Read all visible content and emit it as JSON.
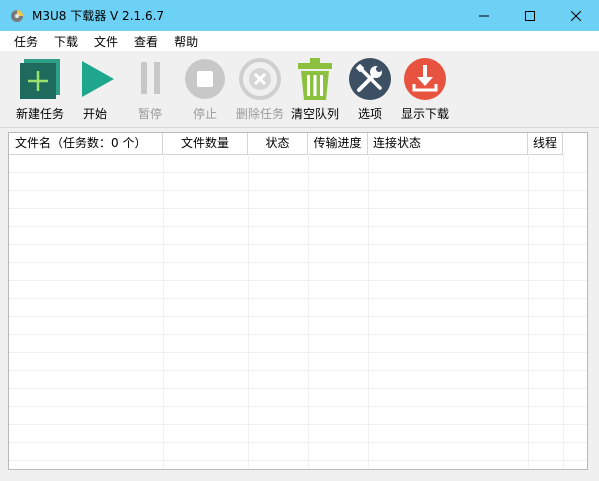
{
  "window": {
    "title": "M3U8 下载器 V 2.1.6.7",
    "minimize_icon": "minimize-icon",
    "maximize_icon": "maximize-icon",
    "close_icon": "close-icon"
  },
  "menu": [
    {
      "label": "任务"
    },
    {
      "label": "下载"
    },
    {
      "label": "文件"
    },
    {
      "label": "查看"
    },
    {
      "label": "帮助"
    }
  ],
  "toolbar": [
    {
      "label": "新建任务",
      "icon": "new-task-icon",
      "enabled": true,
      "color": "#1e7a6a"
    },
    {
      "label": "开始",
      "icon": "play-icon",
      "enabled": true,
      "color": "#1fa78d"
    },
    {
      "label": "暂停",
      "icon": "pause-icon",
      "enabled": false,
      "color": "#c8c8c8"
    },
    {
      "label": "停止",
      "icon": "stop-icon",
      "enabled": false,
      "color": "#c8c8c8"
    },
    {
      "label": "删除任务",
      "icon": "delete-task-icon",
      "enabled": false,
      "color": "#c8c8c8"
    },
    {
      "label": "清空队列",
      "icon": "trash-icon",
      "enabled": true,
      "color": "#8cc13f"
    },
    {
      "label": "选项",
      "icon": "tools-icon",
      "enabled": true,
      "color": "#3d4f63"
    },
    {
      "label": "显示下载",
      "icon": "download-icon",
      "enabled": true,
      "color": "#e8533f"
    }
  ],
  "list": {
    "columns": [
      {
        "label": "文件名（任务数：0 个）"
      },
      {
        "label": "文件数量"
      },
      {
        "label": "状态"
      },
      {
        "label": "传输进度"
      },
      {
        "label": "连接状态"
      },
      {
        "label": "线程"
      }
    ],
    "rows": []
  },
  "colors": {
    "titlebar": "#6dd0f5",
    "toolbar_bg": "#f0f0f0",
    "grid_line": "#f0f0f0"
  }
}
